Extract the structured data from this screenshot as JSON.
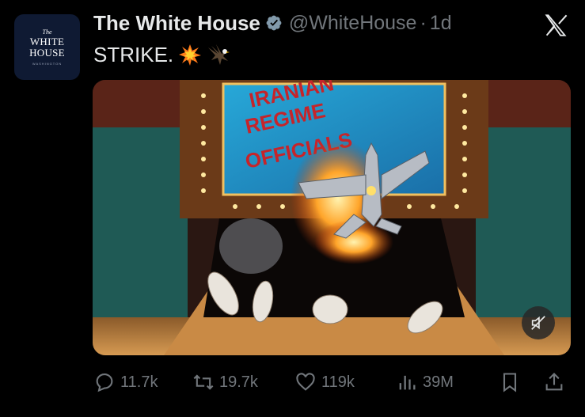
{
  "avatar": {
    "line1": "The",
    "line2": "WHITE",
    "line3": "HOUSE",
    "line4": "WASHINGTON"
  },
  "tweet": {
    "display_name": "The White House",
    "handle": "@WhiteHouse",
    "separator": "·",
    "time": "1d",
    "text": "STRIKE."
  },
  "media": {
    "sign_text": [
      "IRANIAN",
      "REGIME",
      "OFFICIALS"
    ]
  },
  "actions": {
    "replies": "11.7k",
    "reposts": "19.7k",
    "likes": "119k",
    "views": "39M"
  },
  "colors": {
    "background": "#000000",
    "text": "#e7e9ea",
    "secondary": "#71767b",
    "verified": "#829aab"
  },
  "icons": [
    "verified-badge-icon",
    "x-logo-icon",
    "explosion-emoji-icon",
    "eagle-emoji-icon",
    "mute-icon",
    "reply-icon",
    "repost-icon",
    "like-icon",
    "views-icon",
    "bookmark-icon",
    "share-icon"
  ]
}
